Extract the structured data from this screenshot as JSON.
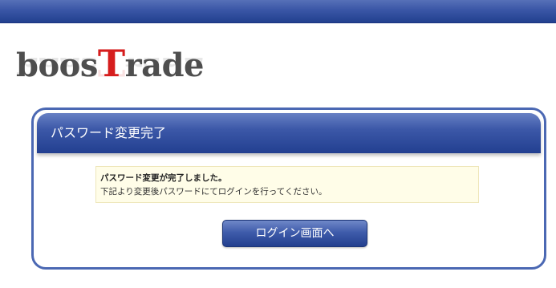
{
  "header_bar": {
    "color": "#2b4697"
  },
  "logo": {
    "text_start": "boos",
    "text_accent": "T",
    "text_end": "rade",
    "accent_color": "#d61d1d",
    "base_color": "#4e4e4e"
  },
  "panel": {
    "title": "パスワード変更完了",
    "notice": {
      "line1": "パスワード変更が完了しました。",
      "line2": "下記より変更後パスワードにてログインを行ってください。"
    },
    "login_button_label": "ログイン画面へ"
  },
  "colors": {
    "accent_blue": "#2b4697",
    "panel_border": "#4b68b3",
    "notice_background": "#fffde8"
  }
}
